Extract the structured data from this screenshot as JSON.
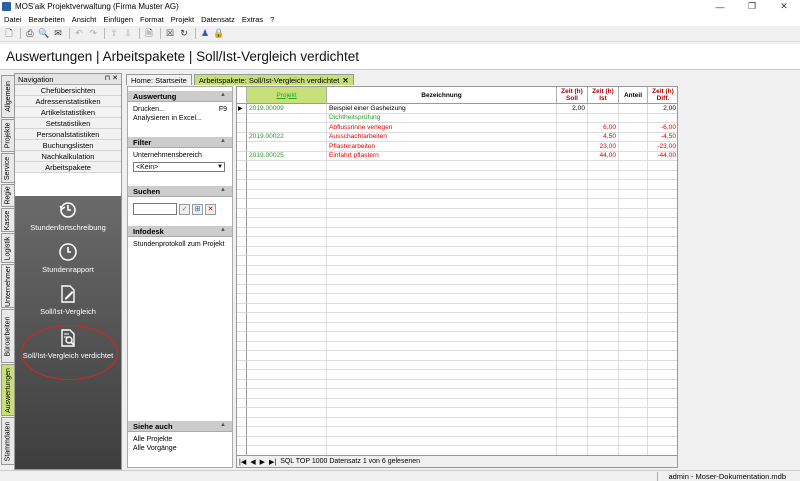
{
  "window": {
    "title": "MOS'aik Projektverwaltung (Firma Muster AG)"
  },
  "menu": [
    "Datei",
    "Bearbeiten",
    "Ansicht",
    "Einfügen",
    "Format",
    "Projekt",
    "Datensatz",
    "Extras",
    "?"
  ],
  "header": {
    "title": "Auswertungen | Arbeitspakete | Soll/Ist-Vergleich verdichtet"
  },
  "vtabs": [
    "Allgemein",
    "Projekte",
    "Service",
    "Regie",
    "Kasse",
    "Logistik",
    "Unternehmer",
    "Büroarbeiten",
    "Auswertungen",
    "Stammdaten"
  ],
  "navigation": {
    "title": "Navigation",
    "items": [
      "Chefübersichten",
      "Adressenstatistiken",
      "Artikelstatistiken",
      "Setstatistiken",
      "Personalstatistiken",
      "Buchungslisten",
      "Nachkalkulation",
      "Arbeitspakete"
    ],
    "big_items": [
      "Stundenfortschreibung",
      "Stundenrapport",
      "Soll/Ist-Vergleich",
      "Soll/Ist-Vergleich verdichtet"
    ]
  },
  "tabs": [
    {
      "label": "Home: Startseite",
      "active": false
    },
    {
      "label": "Arbeitspakete: Soll/Ist-Vergleich verdichtet",
      "active": true
    }
  ],
  "side": {
    "auswertung": {
      "title": "Auswertung",
      "item1": "Drucken...",
      "item1_key": "F9",
      "item2": "Analysieren in Excel..."
    },
    "filter": {
      "title": "Filter",
      "label": "Unternehmensbereich",
      "value": "<Kein>"
    },
    "suchen": {
      "title": "Suchen",
      "value": ""
    },
    "infodesk": {
      "title": "Infodesk",
      "item1": "Stundenprotokoll zum Projekt"
    },
    "siehe": {
      "title": "Siehe auch",
      "item1": "Alle Projekte",
      "item2": "Alle Vorgänge"
    }
  },
  "grid": {
    "columns": [
      "Projekt",
      "Bezeichnung",
      "Zeit (h) Soll",
      "Zeit (h) Ist",
      "Anteil",
      "Zeit (h) Diff."
    ],
    "rows": [
      {
        "projekt": "2019.00009",
        "bezeichnung": "Beispiel einer Gasheizung",
        "soll": "2,00",
        "ist": "",
        "anteil": "",
        "diff": "2,00",
        "style": "black"
      },
      {
        "projekt": "",
        "bezeichnung": "Dichtheitsprüfung",
        "soll": "",
        "ist": "",
        "anteil": "",
        "diff": "",
        "style": "green"
      },
      {
        "projekt": "",
        "bezeichnung": "Abflussrinne verlegen",
        "soll": "",
        "ist": "6,00",
        "anteil": "",
        "diff": "-6,00",
        "style": "red"
      },
      {
        "projekt": "2019.00022",
        "bezeichnung": "Ausschachtarbeiten",
        "soll": "",
        "ist": "4,50",
        "anteil": "",
        "diff": "-4,50",
        "style": "red"
      },
      {
        "projekt": "",
        "bezeichnung": "Pflasterarbeiten",
        "soll": "",
        "ist": "23,00",
        "anteil": "",
        "diff": "-23,00",
        "style": "red"
      },
      {
        "projekt": "2019.00025",
        "bezeichnung": "Einfahrt pflastern",
        "soll": "",
        "ist": "44,00",
        "anteil": "",
        "diff": "-44,00",
        "style": "red"
      }
    ]
  },
  "gridnav": {
    "text": "SQL TOP 1000 Datensatz 1 von 6 gelesenen"
  },
  "status": {
    "text": "admin - Moser-Dokumentation.mdb"
  },
  "colors": {
    "accent": "#c9e07a",
    "red": "#e00000",
    "green": "#2a9a2a",
    "highlight": "#e02020"
  }
}
